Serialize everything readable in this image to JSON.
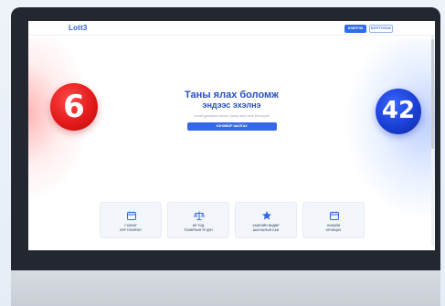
{
  "header": {
    "logo": "Lott3",
    "login_label": "НЭВТРЭХ",
    "register_label": "БҮРТГҮҮЛЭХ"
  },
  "hero": {
    "ball_left": "6",
    "ball_right": "42",
    "title_line1": "Таны ялах боломж",
    "title_line2": "эндээс эхэлнэ",
    "subtitle": "Азтай дугаараа сонгож, супер азын эзэн болоорой",
    "cta_label": "ХОНЖВОР ШАЛГАХ"
  },
  "features": [
    {
      "icon": "calendar-icon",
      "line1": "7 ХОНОГ",
      "line2": "БҮР ТОХИРОЛ"
    },
    {
      "icon": "scale-icon",
      "line1": "ИЛ ТОД",
      "line2": "ТОХИРЛЫН ҮР ДҮН"
    },
    {
      "icon": "star-icon",
      "line1": "ХАМГИЙН ӨНДӨР",
      "line2": "ШАГНАЛЫН САН"
    },
    {
      "icon": "calendar-icon",
      "line1": "ОНЛАЙН",
      "line2": "ОРОЛЦОХ"
    }
  ],
  "colors": {
    "primary": "#2f6ee8",
    "title": "#2a4fbf",
    "ball_red": "#e31a1a",
    "ball_blue": "#1a3fd6"
  }
}
